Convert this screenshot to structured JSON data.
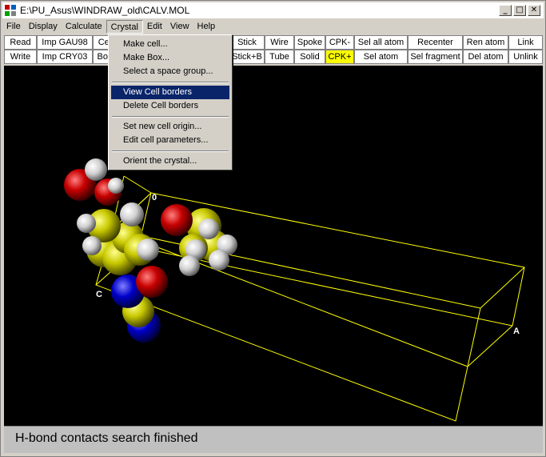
{
  "window": {
    "title": "E:\\PU_Asus\\WINDRAW_old\\CALV.MOL",
    "controls": {
      "minimize": "_",
      "maximize": "□",
      "close": "✕"
    }
  },
  "menubar": {
    "items": [
      "File",
      "Display",
      "Calculate",
      "Crystal",
      "Edit",
      "View",
      "Help"
    ],
    "active": "Crystal"
  },
  "toolbar": {
    "row1": [
      "Read",
      "Imp GAU98",
      "Cel",
      "Stick",
      "Wire",
      "Spoke",
      "CPK-",
      "Sel all atom",
      "Recenter",
      "Ren atom",
      "Link"
    ],
    "row2": [
      "Write",
      "Imp CRY03",
      "Box",
      "Stick+B",
      "Tube",
      "Solid",
      "CPK+",
      "Sel atom",
      "Sel fragment",
      "Del atom",
      "Unlink"
    ],
    "highlight_color": "#ffff00"
  },
  "crystal_menu": {
    "items": [
      "Make cell...",
      "Make Box...",
      "Select a space group...",
      "View Cell borders",
      "Delete Cell borders",
      "Set new cell origin...",
      "Edit cell parameters...",
      "Orient the crystal..."
    ],
    "highlighted": "View Cell borders"
  },
  "viewport": {
    "axis_labels": {
      "origin": "0",
      "c": "C",
      "a": "A"
    },
    "cell_border_color": "#ffff00",
    "atom_colors": {
      "carbon_yellow": "#c8c800",
      "oxygen_red": "#c80000",
      "hydrogen_white": "#d0d0d0",
      "nitrogen_blue": "#0000c8"
    }
  },
  "status": {
    "text": "H-bond contacts search finished"
  }
}
